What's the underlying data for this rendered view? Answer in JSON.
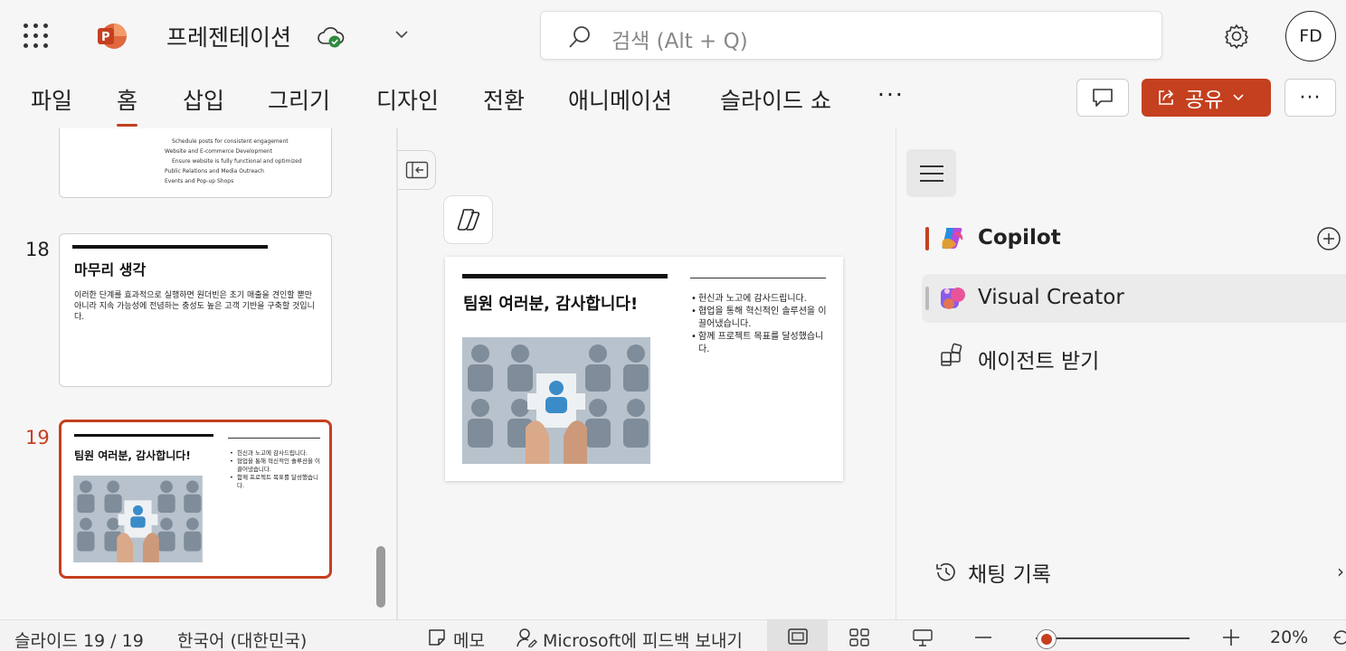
{
  "app": {
    "title": "프레젠테이션",
    "search_placeholder": "검색 (Alt + Q)",
    "avatar_initials": "FD",
    "brand_color": "#c4401f"
  },
  "ribbon": {
    "tabs": [
      "파일",
      "홈",
      "삽입",
      "그리기",
      "디자인",
      "전환",
      "애니메이션",
      "슬라이드 쇼"
    ],
    "active_tab": "홈",
    "more": "···",
    "share_label": "공유",
    "overflow": "···"
  },
  "thumbnails": {
    "slide17_lines": [
      "Schedule posts for consistent engagement",
      "Website and E-commerce Development",
      "Ensure website is fully functional and optimized",
      "Public Relations and Media Outreach",
      "Events and Pop-up Shops"
    ],
    "slide18": {
      "number": "18",
      "title": "마무리 생각",
      "body": "이러한 단계를 효과적으로 실행하면 원더빈은 초기 매출을 견인할 뿐만 아니라 지속 가능성에 전념하는 충성도 높은 고객 기반을 구축할 것입니다."
    },
    "slide19": {
      "number": "19",
      "title": "팀원 여러분, 감사합니다!",
      "bullets": [
        "헌신과 노고에 감사드립니다.",
        "협업을 통해 혁신적인 솔루션을 이끌어냈습니다.",
        "함께 프로젝트 목표를 달성했습니다."
      ]
    }
  },
  "main_slide": {
    "title": "팀원 여러분, 감사합니다!",
    "bullets": [
      "헌신과 노고에 감사드립니다.",
      "협업을 통해 혁신적인 솔루션을 이끌어냈습니다.",
      "함께 프로젝트 목표를 달성했습니다."
    ]
  },
  "copilot_pane": {
    "items": [
      "Copilot",
      "Visual Creator",
      "에이전트 받기"
    ],
    "history": "채팅 기록"
  },
  "statusbar": {
    "slide_position": "슬라이드 19 / 19",
    "language": "한국어 (대한민국)",
    "notes": "메모",
    "feedback": "Microsoft에 피드백 보내기",
    "zoom": "20%",
    "zoom_level": 0.07
  }
}
